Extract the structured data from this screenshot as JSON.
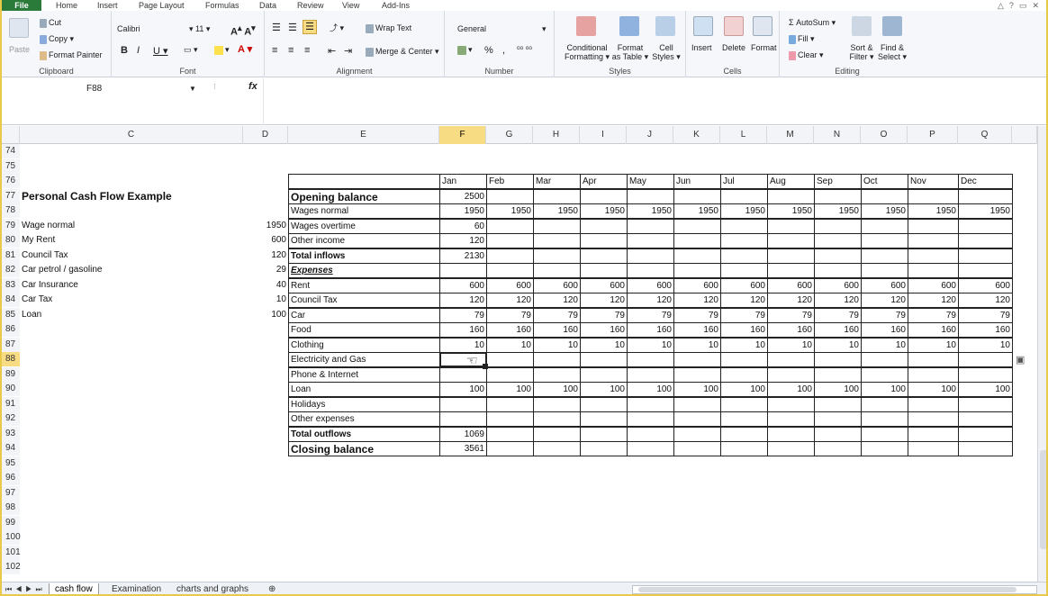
{
  "ribbon_tabs": {
    "file": "File",
    "home": "Home",
    "insert": "Insert",
    "page_layout": "Page Layout",
    "formulas": "Formulas",
    "data": "Data",
    "review": "Review",
    "view": "View",
    "addins": "Add-Ins"
  },
  "clipboard": {
    "paste": "Paste",
    "cut": "Cut",
    "copy": "Copy",
    "format_painter": "Format Painter",
    "label": "Clipboard"
  },
  "font": {
    "name": "Calibri",
    "size": "11",
    "label": "Font"
  },
  "alignment": {
    "wrap_text": "Wrap Text",
    "merge_center": "Merge & Center",
    "label": "Alignment"
  },
  "number": {
    "format": "General",
    "percent": "%",
    "label": "Number"
  },
  "styles": {
    "conditional": "Conditional",
    "formatting": "Formatting",
    "format": "Format",
    "as_table": "as Table",
    "cell": "Cell",
    "cell_styles": "Styles",
    "label": "Styles"
  },
  "cells": {
    "insert": "Insert",
    "delete": "Delete",
    "format": "Format",
    "label": "Cells"
  },
  "editing": {
    "autosum": "AutoSum",
    "fill": "Fill",
    "clear": "Clear",
    "sort": "Sort &",
    "filter": "Filter",
    "find": "Find &",
    "select": "Select",
    "label": "Editing"
  },
  "formula_bar": {
    "name_box": "F88",
    "fx": "fx"
  },
  "columns": [
    "C",
    "D",
    "E",
    "F",
    "G",
    "H",
    "I",
    "J",
    "K",
    "L",
    "M",
    "N",
    "O",
    "P",
    "Q"
  ],
  "rows": [
    "74",
    "75",
    "76",
    "77",
    "78",
    "79",
    "80",
    "81",
    "82",
    "83",
    "84",
    "85",
    "86",
    "87",
    "88",
    "89",
    "90",
    "91",
    "92",
    "93",
    "94",
    "95",
    "96",
    "97",
    "98",
    "99",
    "100",
    "101",
    "102"
  ],
  "selected": {
    "col": "F",
    "row": "88"
  },
  "left_list": {
    "title": "Personal Cash Flow Example",
    "items": [
      {
        "label": "Wage normal",
        "value": "1950"
      },
      {
        "label": "My Rent",
        "value": "600"
      },
      {
        "label": "Council Tax",
        "value": "120"
      },
      {
        "label": "Car petrol / gasoline",
        "value": "29"
      },
      {
        "label": "Car Insurance",
        "value": "40"
      },
      {
        "label": "Car Tax",
        "value": "10"
      },
      {
        "label": "Loan",
        "value": "100"
      }
    ]
  },
  "months": [
    "Jan",
    "Feb",
    "Mar",
    "Apr",
    "May",
    "Jun",
    "Jul",
    "Aug",
    "Sep",
    "Oct",
    "Nov",
    "Dec"
  ],
  "table_rows": [
    {
      "label": "Opening balance",
      "style": "big",
      "values": [
        "2500",
        "",
        "",
        "",
        "",
        "",
        "",
        "",
        "",
        "",
        "",
        ""
      ]
    },
    {
      "label": "Wages normal",
      "style": "",
      "values": [
        "1950",
        "1950",
        "1950",
        "1950",
        "1950",
        "1950",
        "1950",
        "1950",
        "1950",
        "1950",
        "1950",
        "1950"
      ]
    },
    {
      "label": "Wages overtime",
      "style": "",
      "values": [
        "60",
        "",
        "",
        "",
        "",
        "",
        "",
        "",
        "",
        "",
        "",
        ""
      ]
    },
    {
      "label": "Other income",
      "style": "",
      "values": [
        "120",
        "",
        "",
        "",
        "",
        "",
        "",
        "",
        "",
        "",
        "",
        ""
      ]
    },
    {
      "label": "Total inflows",
      "style": "bold",
      "values": [
        "2130",
        "",
        "",
        "",
        "",
        "",
        "",
        "",
        "",
        "",
        "",
        ""
      ]
    },
    {
      "label": "Expenses",
      "style": "ital",
      "values": [
        "",
        "",
        "",
        "",
        "",
        "",
        "",
        "",
        "",
        "",
        "",
        ""
      ]
    },
    {
      "label": "Rent",
      "style": "",
      "values": [
        "600",
        "600",
        "600",
        "600",
        "600",
        "600",
        "600",
        "600",
        "600",
        "600",
        "600",
        "600"
      ]
    },
    {
      "label": "Council Tax",
      "style": "",
      "values": [
        "120",
        "120",
        "120",
        "120",
        "120",
        "120",
        "120",
        "120",
        "120",
        "120",
        "120",
        "120"
      ]
    },
    {
      "label": "Car",
      "style": "",
      "values": [
        "79",
        "79",
        "79",
        "79",
        "79",
        "79",
        "79",
        "79",
        "79",
        "79",
        "79",
        "79"
      ]
    },
    {
      "label": "Food",
      "style": "",
      "values": [
        "160",
        "160",
        "160",
        "160",
        "160",
        "160",
        "160",
        "160",
        "160",
        "160",
        "160",
        "160"
      ]
    },
    {
      "label": "Clothing",
      "style": "",
      "values": [
        "10",
        "10",
        "10",
        "10",
        "10",
        "10",
        "10",
        "10",
        "10",
        "10",
        "10",
        "10"
      ]
    },
    {
      "label": "Electricity and Gas",
      "style": "",
      "values": [
        "",
        "",
        "",
        "",
        "",
        "",
        "",
        "",
        "",
        "",
        "",
        ""
      ]
    },
    {
      "label": "Phone & Internet",
      "style": "",
      "values": [
        "",
        "",
        "",
        "",
        "",
        "",
        "",
        "",
        "",
        "",
        "",
        ""
      ]
    },
    {
      "label": "Loan",
      "style": "",
      "values": [
        "100",
        "100",
        "100",
        "100",
        "100",
        "100",
        "100",
        "100",
        "100",
        "100",
        "100",
        "100"
      ]
    },
    {
      "label": "Holidays",
      "style": "",
      "values": [
        "",
        "",
        "",
        "",
        "",
        "",
        "",
        "",
        "",
        "",
        "",
        ""
      ]
    },
    {
      "label": "Other expenses",
      "style": "",
      "values": [
        "",
        "",
        "",
        "",
        "",
        "",
        "",
        "",
        "",
        "",
        "",
        ""
      ]
    },
    {
      "label": "Total outflows",
      "style": "bold",
      "values": [
        "1069",
        "",
        "",
        "",
        "",
        "",
        "",
        "",
        "",
        "",
        "",
        ""
      ]
    },
    {
      "label": "Closing balance",
      "style": "big",
      "values": [
        "3561",
        "",
        "",
        "",
        "",
        "",
        "",
        "",
        "",
        "",
        "",
        ""
      ]
    }
  ],
  "sheet_tabs": [
    "cash flow",
    "Examination",
    "charts and graphs"
  ],
  "active_sheet": "cash flow",
  "colors": {
    "selected_header": "#f8dc84",
    "file_tab": "#2a7a3a",
    "frame": "#e9c94a"
  }
}
